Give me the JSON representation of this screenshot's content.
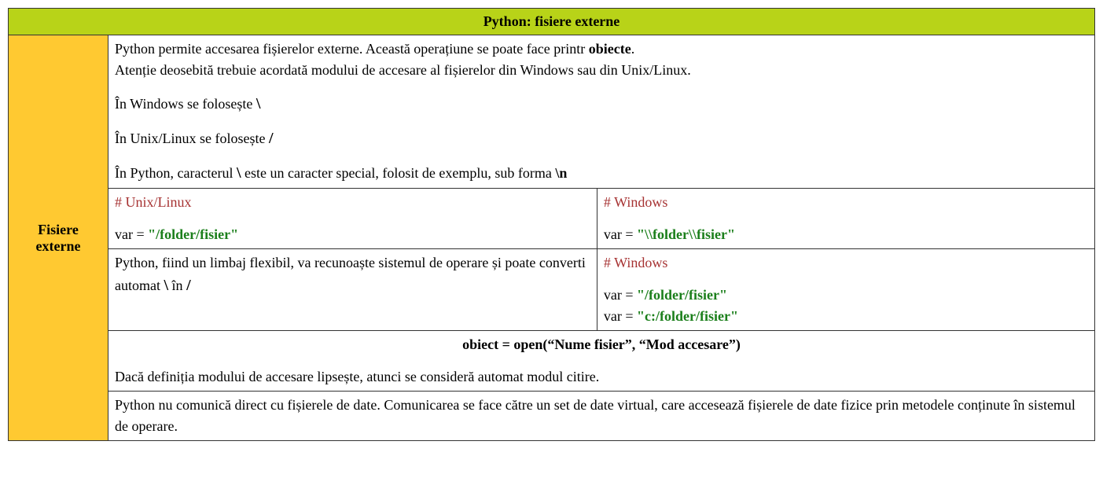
{
  "header": "Python: fisiere externe",
  "side_label_l1": "Fisiere",
  "side_label_l2": "externe",
  "r1": {
    "intro_a": "Python permite accesarea fișierelor externe. Această operațiune se poate face printr ",
    "intro_b": "obiecte",
    "intro_c": ".",
    "attn": "Atenție deosebită trebuie acordată modului de accesare al fișierelor din Windows sau din Unix/Linux.",
    "win_a": "În Windows se folosește ",
    "win_b": "\\",
    "unix_a": "În Unix/Linux se folosește ",
    "unix_b": "/",
    "py_a": "În Python, caracterul ",
    "py_b": "\\",
    "py_c": " este un caracter special, folosit de exemplu, sub forma ",
    "py_d": "\\n"
  },
  "r2": {
    "left_comment": "# Unix/Linux",
    "left_prefix": "var = ",
    "left_string": "\"/folder/fisier\"",
    "right_comment": "# Windows",
    "right_prefix": "var = ",
    "right_string": "\"\\\\folder\\\\fisier\""
  },
  "r3": {
    "left_a": "Python, fiind un limbaj flexibil, va recunoaște sistemul de operare și poate converti automat ",
    "left_b": "\\",
    "left_c": " în ",
    "left_d": "/",
    "right_comment": "# Windows",
    "right_p1": "var = ",
    "right_s1": "\"/folder/fisier\"",
    "right_p2": "var = ",
    "right_s2": "\"c:/folder/fisier\""
  },
  "r4": {
    "code": "obiect = open(“Nume fisier”, “Mod accesare”)",
    "note": "Dacă definiția modului de accesare lipsește, atunci se consideră automat modul citire."
  },
  "r5": {
    "text": "Python nu comunică direct cu fișierele de date. Comunicarea se face către un set de date virtual, care accesează fișierele de date fizice prin metodele conținute în sistemul de operare."
  }
}
